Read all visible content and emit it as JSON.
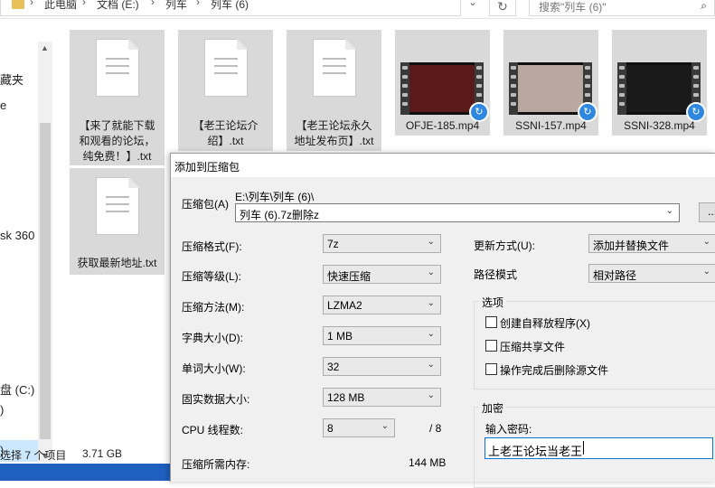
{
  "explorer": {
    "breadcrumb": [
      "此电脑",
      "文档 (E:)",
      "列车",
      "列车 (6)"
    ],
    "search_placeholder": "搜索\"列车 (6)\"",
    "nav_items": [
      "藏夹",
      "e",
      "sk 360",
      "盘 (C:)",
      ")",
      ")"
    ],
    "status_selected": "选择 7 个项目",
    "status_size": "3.71 GB",
    "files": [
      {
        "name": "【来了就能下载和观看的论坛，纯免费！】.txt",
        "lines": [
          "【来了就能下载",
          "和观看的论坛，",
          "纯免费！】.txt"
        ],
        "kind": "txt"
      },
      {
        "name": "【老王论坛介绍】.txt",
        "lines": [
          "【老王论坛介",
          "绍】.txt"
        ],
        "kind": "txt"
      },
      {
        "name": "【老王论坛永久地址发布页】.txt",
        "lines": [
          "【老王论坛永久",
          "地址发布页】.txt"
        ],
        "kind": "txt"
      },
      {
        "name": "OFJE-185.mp4",
        "lines": [
          "OFJE-185.mp4"
        ],
        "kind": "video",
        "thumb_color": "#5a1a1a"
      },
      {
        "name": "SSNI-157.mp4",
        "lines": [
          "SSNI-157.mp4"
        ],
        "kind": "video",
        "thumb_color": "#b8a8a0"
      },
      {
        "name": "SSNI-328.mp4",
        "lines": [
          "SSNI-328.mp4"
        ],
        "kind": "video",
        "thumb_color": "#1a1a1a"
      },
      {
        "name": "获取最新地址.txt",
        "lines": [
          "获取最新地址.txt"
        ],
        "kind": "txt"
      }
    ]
  },
  "dialog": {
    "title": "添加到压缩包",
    "archive_label": "压缩包(A)",
    "archive_path": "E:\\列车\\列车 (6)\\",
    "archive_name": "列车 (6).7z删除z",
    "browse_label": "...",
    "format_label": "压缩格式(F):",
    "format_value": "7z",
    "level_label": "压缩等级(L):",
    "level_value": "快速压缩",
    "method_label": "压缩方法(M):",
    "method_value": "LZMA2",
    "dict_label": "字典大小(D):",
    "dict_value": "1 MB",
    "word_label": "单词大小(W):",
    "word_value": "32",
    "solid_label": "固实数据大小:",
    "solid_value": "128 MB",
    "cpu_label": "CPU 线程数:",
    "cpu_value": "8",
    "cpu_total": "/ 8",
    "memory_label": "压缩所需内存:",
    "memory_value": "144 MB",
    "update_label": "更新方式(U):",
    "update_value": "添加并替换文件",
    "path_label": "路径模式",
    "path_value": "相对路径",
    "options_title": "选项",
    "options": [
      "创建自释放程序(X)",
      "压缩共享文件",
      "操作完成后删除源文件"
    ],
    "encrypt_title": "加密",
    "password_label": "输入密码:",
    "password_value": "上老王论坛当老王"
  }
}
